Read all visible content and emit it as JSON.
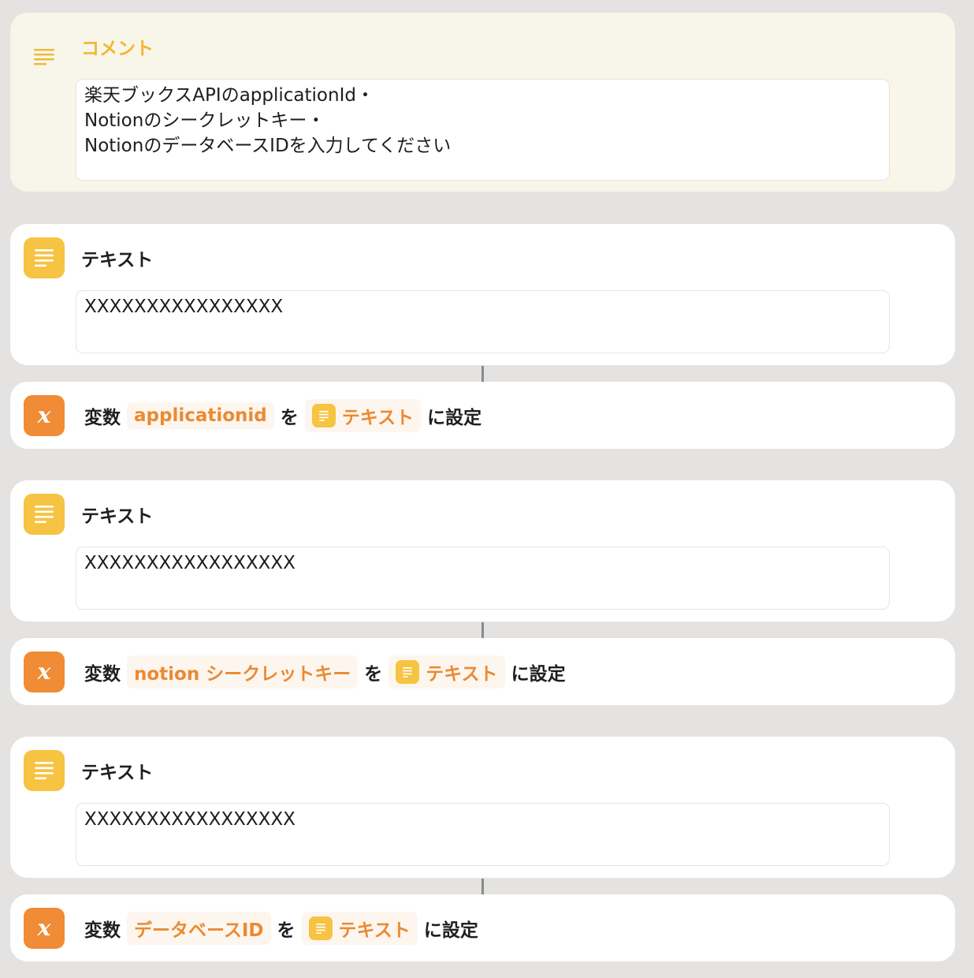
{
  "comment": {
    "title": "コメント",
    "text": "楽天ブックスAPIのapplicationId・\nNotionのシークレットキー・\nNotionのデータベースIDを入力してください"
  },
  "text_actions": [
    {
      "title": "テキスト",
      "value": "XXXXXXXXXXXXXXXX"
    },
    {
      "title": "テキスト",
      "value": "XXXXXXXXXXXXXXXXX"
    },
    {
      "title": "テキスト",
      "value": "XXXXXXXXXXXXXXXXX"
    }
  ],
  "set_variable": [
    {
      "prefix": "変数",
      "variable": "applicationid",
      "particle": "を",
      "input": "テキスト",
      "suffix": "に設定"
    },
    {
      "prefix": "変数",
      "variable": "notion シークレットキー",
      "particle": "を",
      "input": "テキスト",
      "suffix": "に設定"
    },
    {
      "prefix": "変数",
      "variable": "データベースID",
      "particle": "を",
      "input": "テキスト",
      "suffix": "に設定"
    }
  ],
  "icons": {
    "comment": "lines-icon",
    "text": "text-lines-icon",
    "variable": "variable-x-icon"
  },
  "colors": {
    "background": "#e4e3e1",
    "comment_card": "#f8f5e9",
    "comment_accent": "#f0b733",
    "text_icon": "#f6c342",
    "variable_icon": "#ef8c35",
    "token_text": "#ea8a33"
  }
}
